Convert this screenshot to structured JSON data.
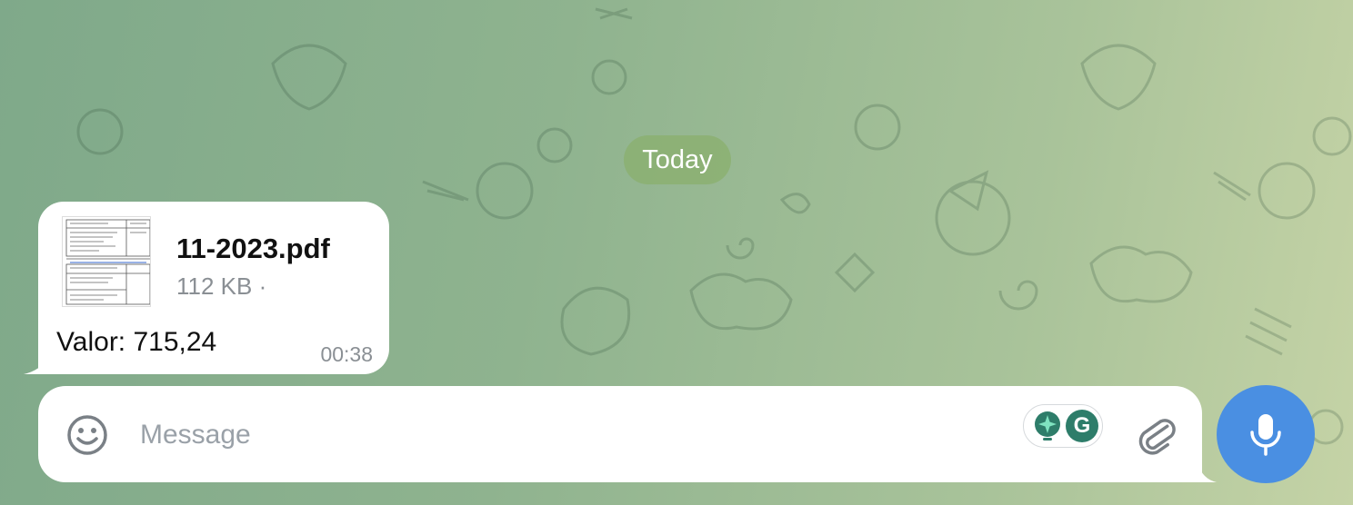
{
  "chat": {
    "date_separator": "Today",
    "message": {
      "file_name": "11-2023.pdf",
      "file_size": "112 KB ·",
      "caption": "Valor: 715,24",
      "time": "00:38"
    }
  },
  "composer": {
    "placeholder": "Message",
    "value": "",
    "extension_letter": "G"
  },
  "icons": {
    "emoji": "smiley-icon",
    "attach": "paperclip-icon",
    "mic": "microphone-icon",
    "extension_ai": "sparkle-bulb-icon",
    "extension_grammarly": "grammarly-icon"
  },
  "colors": {
    "accent": "#4a8fe2",
    "date_pill": "#8ab06e",
    "bubble": "#ffffff",
    "secondary_text": "#8a8f94"
  }
}
